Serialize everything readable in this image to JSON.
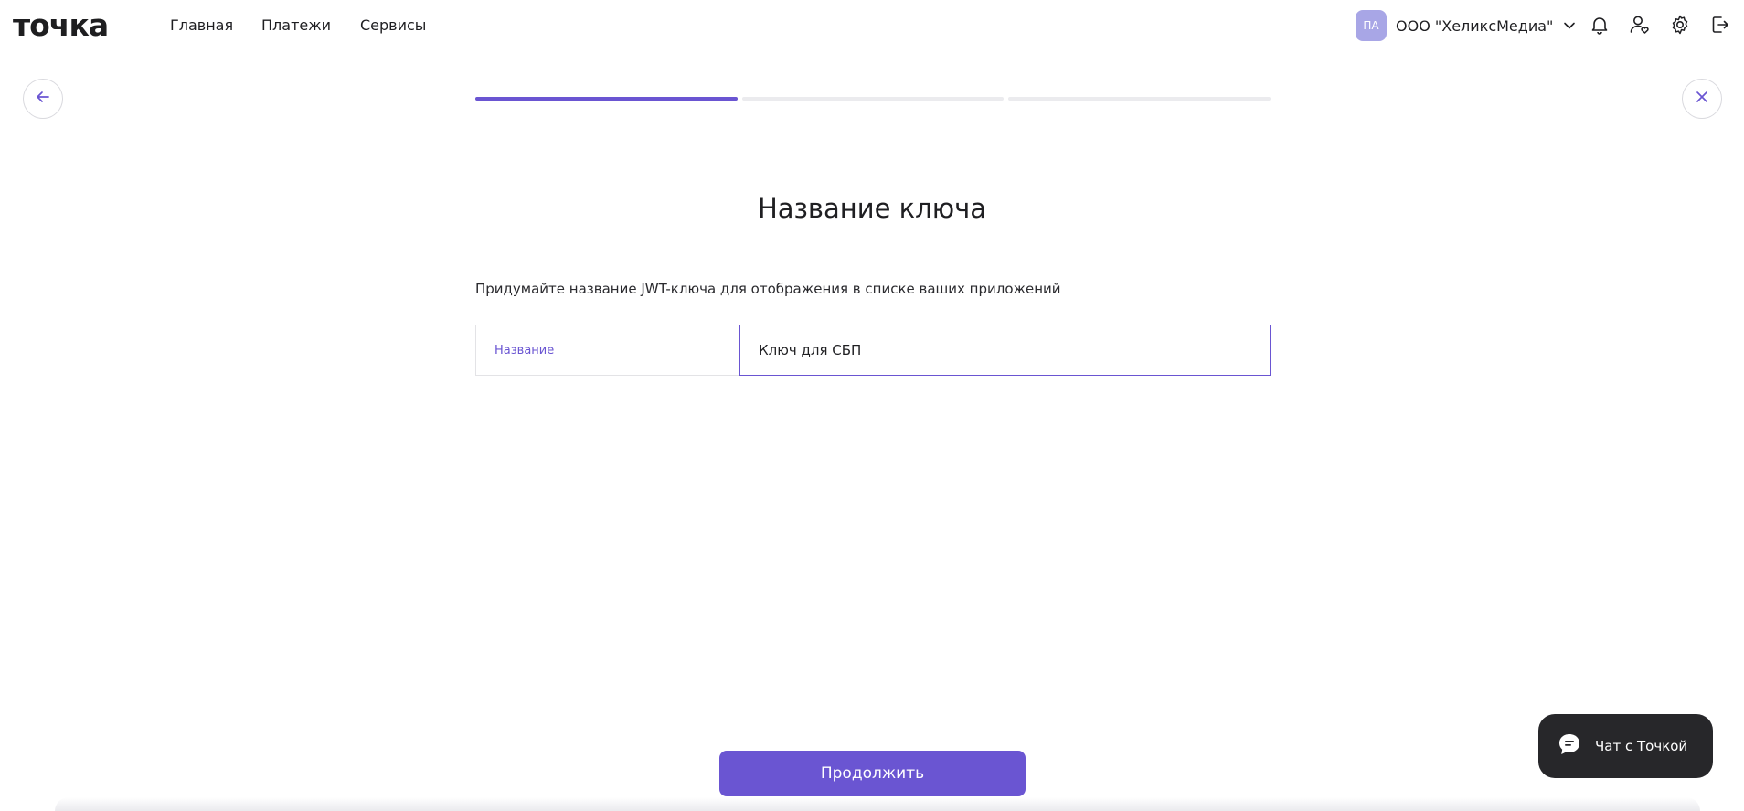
{
  "header": {
    "logo": "точка",
    "nav": [
      "Главная",
      "Платежи",
      "Сервисы"
    ],
    "org": {
      "avatar_initials": "ПА",
      "name": "ООО \"ХеликсМедиа\""
    },
    "icons": [
      "bell-icon",
      "user-heart-icon",
      "gear-icon",
      "logout-icon"
    ]
  },
  "wizard": {
    "progress": {
      "steps_total": 3,
      "current_step": 1
    },
    "title": "Название ключа",
    "description": "Придумайте название JWT-ключа для отображения в списке ваших приложений",
    "field": {
      "label": "Название",
      "value": "Ключ для СБП"
    },
    "continue_label": "Продолжить"
  },
  "chat": {
    "label": "Чат с Точкой"
  },
  "colors": {
    "accent": "#6a55d2",
    "chat_bg": "#27272a",
    "avatar_bg": "#a8a6e6"
  }
}
